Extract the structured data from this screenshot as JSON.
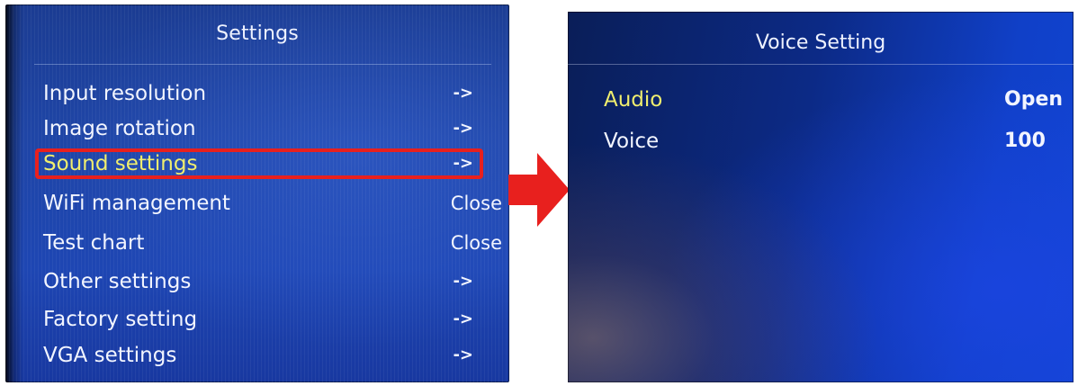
{
  "settings_screen": {
    "title": "Settings",
    "items": [
      {
        "label": "Input resolution",
        "value": "->"
      },
      {
        "label": "Image rotation",
        "value": "->"
      },
      {
        "label": "Sound settings",
        "value": "->",
        "selected": true
      },
      {
        "label": "WiFi management",
        "value": "Close"
      },
      {
        "label": "Test chart",
        "value": "Close"
      },
      {
        "label": "Other settings",
        "value": "->"
      },
      {
        "label": "Factory setting",
        "value": "->"
      },
      {
        "label": "VGA settings",
        "value": "->"
      }
    ],
    "highlight_color": "#e8201e",
    "selected_text_color": "#f0ee6e"
  },
  "transition_arrow": {
    "icon": "right-arrow-icon",
    "color": "#e8201e"
  },
  "voice_screen": {
    "title": "Voice Setting",
    "items": [
      {
        "label": "Audio",
        "value": "Open",
        "selected": true
      },
      {
        "label": "Voice",
        "value": "100"
      }
    ]
  }
}
